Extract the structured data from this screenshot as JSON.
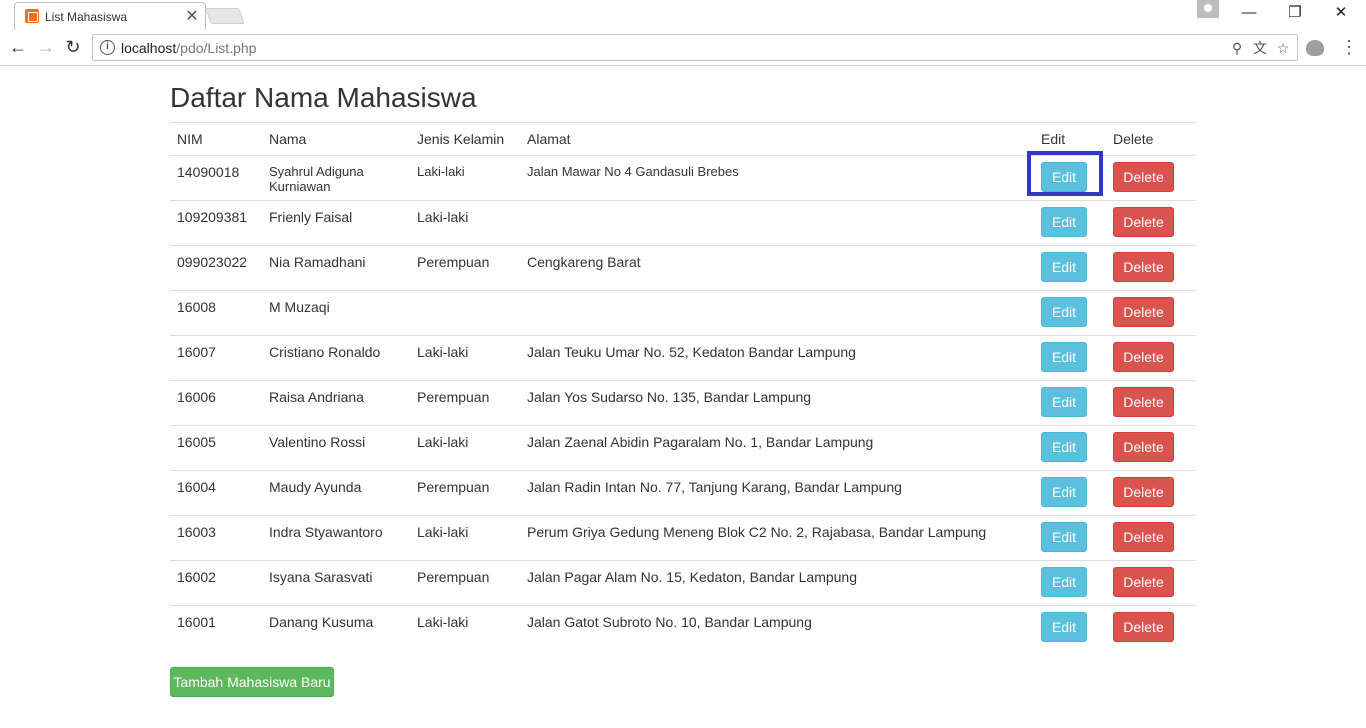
{
  "browser": {
    "tab_title": "List Mahasiswa",
    "tab_close": "✕",
    "url_host": "localhost",
    "url_path": "/pdo/List.php",
    "icons": [
      "back-icon",
      "forward-icon",
      "reload-icon",
      "info-icon",
      "zoom-icon",
      "translate-icon",
      "star-icon",
      "extension-icon",
      "menu-icon"
    ]
  },
  "page": {
    "title": "Daftar Nama Mahasiswa",
    "columns": [
      "NIM",
      "Nama",
      "Jenis Kelamin",
      "Alamat",
      "Edit",
      "Delete"
    ],
    "rows": [
      {
        "nim": "14090018",
        "nama": "Syahrul Adiguna Kurniawan",
        "jk": "Laki-laki",
        "alamat": "Jalan Mawar No 4 Gandasuli Brebes",
        "edit": "Edit",
        "delete": "Delete"
      },
      {
        "nim": "109209381",
        "nama": "Frienly Faisal",
        "jk": "Laki-laki",
        "alamat": "",
        "edit": "Edit",
        "delete": "Delete"
      },
      {
        "nim": "099023022",
        "nama": "Nia Ramadhani",
        "jk": "Perempuan",
        "alamat": "Cengkareng Barat",
        "edit": "Edit",
        "delete": "Delete"
      },
      {
        "nim": "16008",
        "nama": "M Muzaqi",
        "jk": "",
        "alamat": "",
        "edit": "Edit",
        "delete": "Delete"
      },
      {
        "nim": "16007",
        "nama": "Cristiano Ronaldo",
        "jk": "Laki-laki",
        "alamat": "Jalan Teuku Umar No. 52, Kedaton Bandar Lampung",
        "edit": "Edit",
        "delete": "Delete"
      },
      {
        "nim": "16006",
        "nama": "Raisa Andriana",
        "jk": "Perempuan",
        "alamat": "Jalan Yos Sudarso No. 135, Bandar Lampung",
        "edit": "Edit",
        "delete": "Delete"
      },
      {
        "nim": "16005",
        "nama": "Valentino Rossi",
        "jk": "Laki-laki",
        "alamat": "Jalan Zaenal Abidin Pagaralam No. 1, Bandar Lampung",
        "edit": "Edit",
        "delete": "Delete"
      },
      {
        "nim": "16004",
        "nama": "Maudy Ayunda",
        "jk": "Perempuan",
        "alamat": "Jalan Radin Intan No. 77, Tanjung Karang, Bandar Lampung",
        "edit": "Edit",
        "delete": "Delete"
      },
      {
        "nim": "16003",
        "nama": "Indra Styawantoro",
        "jk": "Laki-laki",
        "alamat": "Perum Griya Gedung Meneng Blok C2 No. 2, Rajabasa, Bandar Lampung",
        "edit": "Edit",
        "delete": "Delete"
      },
      {
        "nim": "16002",
        "nama": "Isyana Sarasvati",
        "jk": "Perempuan",
        "alamat": "Jalan Pagar Alam No. 15, Kedaton, Bandar Lampung",
        "edit": "Edit",
        "delete": "Delete"
      },
      {
        "nim": "16001",
        "nama": "Danang Kusuma",
        "jk": "Laki-laki",
        "alamat": "Jalan Gatot Subroto No. 10, Bandar Lampung",
        "edit": "Edit",
        "delete": "Delete"
      }
    ],
    "add_button": "Tambah Mahasiswa Baru"
  },
  "colors": {
    "edit": "#5bc0de",
    "delete": "#d9534f",
    "add": "#5cb85c",
    "highlight": "#3238bf"
  }
}
